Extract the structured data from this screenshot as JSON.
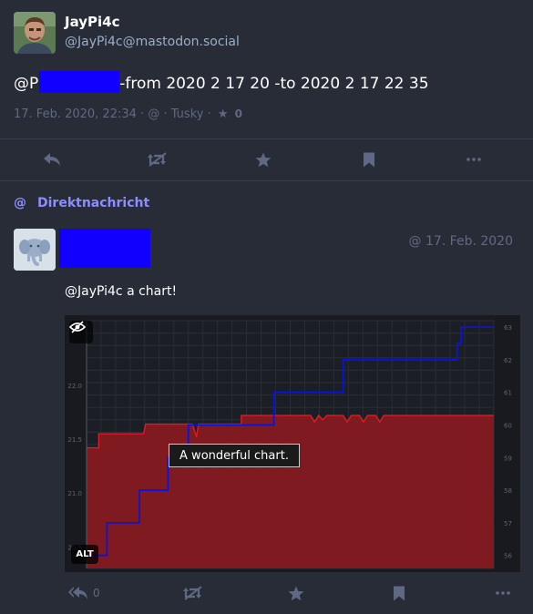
{
  "main_status": {
    "display_name": "JayPi4c",
    "account": "@JayPi4c@mastodon.social",
    "content_prefix": "@P",
    "content_rest": "-from 2020 2 17 20 -to 2020 2 17 22 35",
    "timestamp": "17. Feb. 2020, 22:34",
    "visibility_glyph": "@",
    "application": "Tusky",
    "favourites_count": "0"
  },
  "direct_label": {
    "icon": "@",
    "text": "Direktnachricht"
  },
  "reply": {
    "time": "@ 17. Feb. 2020",
    "text": "@JayPi4c a chart!",
    "alt_badge": "ALT",
    "tooltip": "A wonderful chart.",
    "replies_count": "0"
  },
  "colors": {
    "background": "#282c37",
    "accent": "#8c8dff",
    "muted": "#606984",
    "redaction": "#1200ff",
    "chart_area": "#8a1a20",
    "chart_line_red": "#e01b22",
    "chart_line_blue": "#0a14d8"
  },
  "chart_data": {
    "type": "line",
    "left_axis_ticks": [
      "22.0",
      "21.5",
      "21.0",
      "20.5"
    ],
    "left_axis_values": [
      22.0,
      21.5,
      21.0,
      20.5
    ],
    "right_axis_ticks": [
      "63",
      "62",
      "61",
      "60",
      "59",
      "58",
      "57",
      "56"
    ],
    "right_axis_values": [
      63,
      62,
      61,
      60,
      59,
      58,
      57,
      56
    ],
    "ylim_left": [
      20.3,
      22.6
    ],
    "ylim_right": [
      55.6,
      63.2
    ],
    "xlim": [
      0,
      100
    ],
    "grid": true,
    "series": [
      {
        "axis": "left",
        "style": "area",
        "x": [
          0,
          3,
          3,
          14,
          14,
          14.5,
          15,
          26,
          26,
          27,
          27.5,
          28,
          38,
          38,
          40,
          40,
          55,
          55,
          56,
          57,
          58,
          59,
          60,
          61,
          62,
          63,
          64,
          65,
          66,
          67,
          68,
          69,
          70,
          71,
          72,
          73,
          74,
          75,
          100
        ],
        "y": [
          21.42,
          21.42,
          21.55,
          21.55,
          21.55,
          21.64,
          21.64,
          21.64,
          21.64,
          21.52,
          21.64,
          21.64,
          21.64,
          21.72,
          21.72,
          21.72,
          21.72,
          21.72,
          21.66,
          21.72,
          21.68,
          21.72,
          21.72,
          21.72,
          21.72,
          21.72,
          21.66,
          21.72,
          21.72,
          21.72,
          21.66,
          21.72,
          21.72,
          21.72,
          21.66,
          21.72,
          21.72,
          21.72,
          21.72
        ]
      },
      {
        "axis": "right",
        "style": "step",
        "x": [
          0,
          5,
          5,
          13,
          13,
          20,
          20,
          25,
          25,
          30,
          30,
          46,
          46,
          63,
          63,
          81,
          81,
          91,
          91,
          92,
          92,
          100
        ],
        "y": [
          56,
          56,
          57,
          57,
          58,
          58,
          59,
          59,
          60,
          60,
          60,
          60,
          61,
          61,
          62,
          62,
          62,
          62,
          62.5,
          62.5,
          63,
          63
        ]
      }
    ]
  }
}
